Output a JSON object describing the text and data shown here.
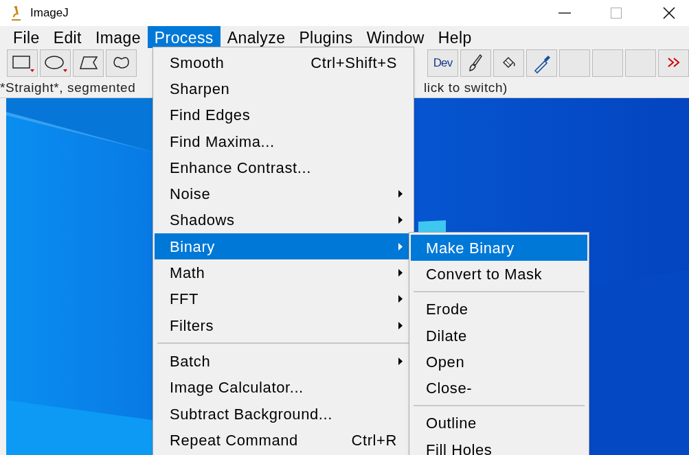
{
  "window": {
    "title": "ImageJ"
  },
  "menu_bar": [
    {
      "label": "File",
      "selected": false
    },
    {
      "label": "Edit",
      "selected": false
    },
    {
      "label": "Image",
      "selected": false
    },
    {
      "label": "Process",
      "selected": true
    },
    {
      "label": "Analyze",
      "selected": false
    },
    {
      "label": "Plugins",
      "selected": false
    },
    {
      "label": "Window",
      "selected": false
    },
    {
      "label": "Help",
      "selected": false
    }
  ],
  "toolbar_left": [
    {
      "kind": "rectangle"
    },
    {
      "kind": "oval"
    },
    {
      "kind": "polygon"
    },
    {
      "kind": "freehand"
    }
  ],
  "toolbar_right": [
    {
      "kind": "dev",
      "label": "Dev"
    },
    {
      "kind": "brush"
    },
    {
      "kind": "fill"
    },
    {
      "kind": "dropper"
    },
    {
      "kind": "empty"
    },
    {
      "kind": "empty"
    },
    {
      "kind": "empty"
    },
    {
      "kind": "more"
    }
  ],
  "status_bar": {
    "left": "*Straight*, segmented",
    "right": "lick to switch)"
  },
  "process_menu": [
    {
      "kind": "item",
      "label": "Smooth",
      "shortcut": "Ctrl+Shift+S",
      "submenu": false,
      "selected": false
    },
    {
      "kind": "item",
      "label": "Sharpen",
      "submenu": false,
      "selected": false
    },
    {
      "kind": "item",
      "label": "Find Edges",
      "submenu": false,
      "selected": false
    },
    {
      "kind": "item",
      "label": "Find Maxima...",
      "submenu": false,
      "selected": false
    },
    {
      "kind": "item",
      "label": "Enhance Contrast...",
      "submenu": false,
      "selected": false
    },
    {
      "kind": "item",
      "label": "Noise",
      "submenu": true,
      "selected": false
    },
    {
      "kind": "item",
      "label": "Shadows",
      "submenu": true,
      "selected": false
    },
    {
      "kind": "item",
      "label": "Binary",
      "submenu": true,
      "selected": true
    },
    {
      "kind": "item",
      "label": "Math",
      "submenu": true,
      "selected": false
    },
    {
      "kind": "item",
      "label": "FFT",
      "submenu": true,
      "selected": false
    },
    {
      "kind": "item",
      "label": "Filters",
      "submenu": true,
      "selected": false
    },
    {
      "kind": "separator"
    },
    {
      "kind": "item",
      "label": "Batch",
      "submenu": true,
      "selected": false
    },
    {
      "kind": "item",
      "label": "Image Calculator...",
      "submenu": false,
      "selected": false
    },
    {
      "kind": "item",
      "label": "Subtract Background...",
      "submenu": false,
      "selected": false
    },
    {
      "kind": "item",
      "label": "Repeat Command",
      "shortcut": "Ctrl+R",
      "submenu": false,
      "selected": false
    }
  ],
  "binary_submenu": [
    {
      "kind": "item",
      "label": "Make Binary",
      "selected": true
    },
    {
      "kind": "item",
      "label": "Convert to Mask",
      "selected": false
    },
    {
      "kind": "separator"
    },
    {
      "kind": "item",
      "label": "Erode",
      "selected": false
    },
    {
      "kind": "item",
      "label": "Dilate",
      "selected": false
    },
    {
      "kind": "item",
      "label": "Open",
      "selected": false
    },
    {
      "kind": "item",
      "label": "Close-",
      "selected": false
    },
    {
      "kind": "separator"
    },
    {
      "kind": "item",
      "label": "Outline",
      "selected": false
    },
    {
      "kind": "item",
      "label": "Fill Holes",
      "selected": false
    }
  ]
}
